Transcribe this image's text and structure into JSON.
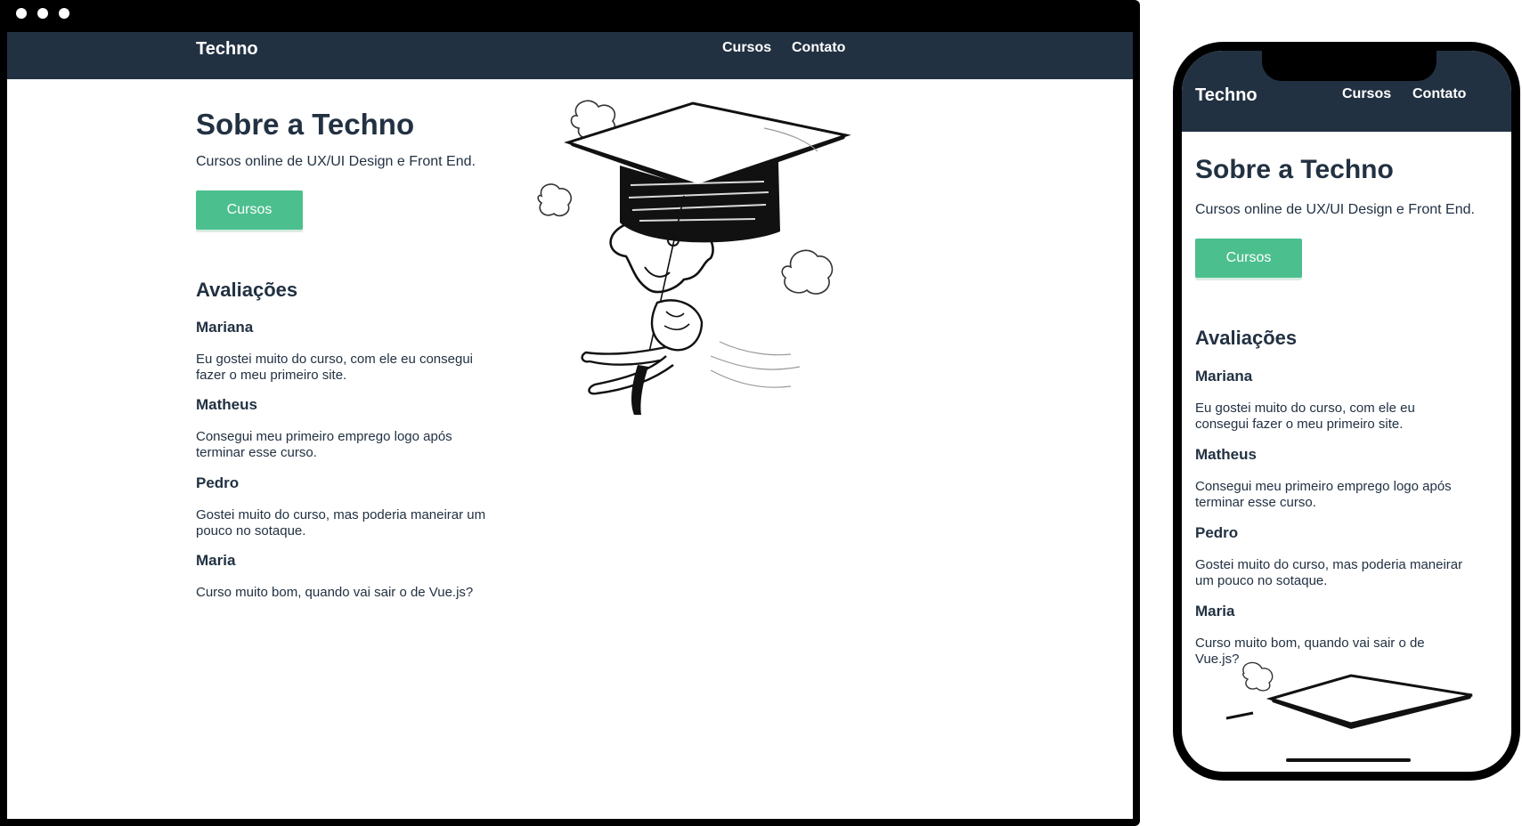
{
  "site": {
    "brand": "Techno",
    "nav": [
      {
        "label": "Cursos"
      },
      {
        "label": "Contato"
      }
    ],
    "hero": {
      "title": "Sobre a Techno",
      "subtitle": "Cursos online de UX/UI Design e Front End.",
      "button_label": "Cursos"
    },
    "reviews_title": "Avaliações",
    "reviews": [
      {
        "name": "Mariana",
        "text": "Eu gostei muito do curso, com ele eu consegui fazer o meu primeiro site."
      },
      {
        "name": "Matheus",
        "text": "Consegui meu primeiro emprego logo após terminar esse curso."
      },
      {
        "name": "Pedro",
        "text": "Gostei muito do curso, mas poderia maneirar um pouco no sotaque."
      },
      {
        "name": "Maria",
        "text": "Curso muito bom, quando vai sair o de Vue.js?"
      }
    ]
  },
  "colors": {
    "nav_bg": "#223142",
    "text": "#223142",
    "button": "#4cbf8e",
    "frame": "#000000"
  },
  "illustration": {
    "icon": "graduation-cap-illustration-icon"
  }
}
